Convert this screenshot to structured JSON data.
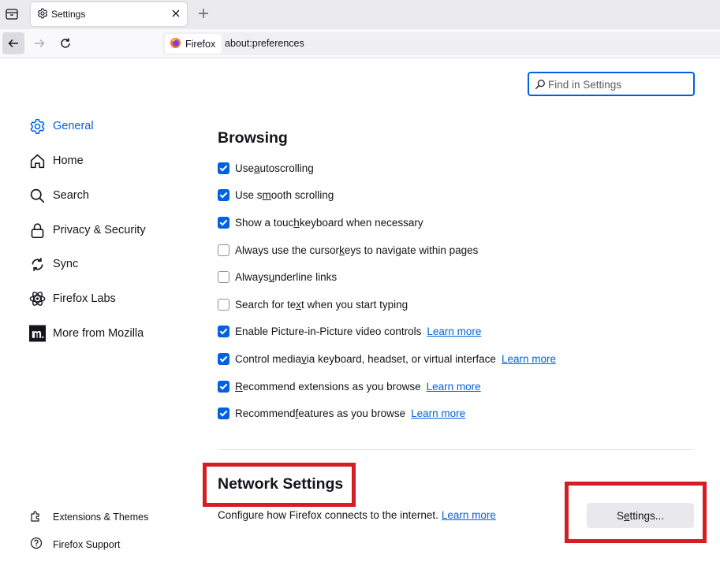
{
  "browser": {
    "tab": {
      "title": "Settings"
    },
    "identity_label": "Firefox",
    "url": "about:preferences"
  },
  "search": {
    "placeholder": "Find in Settings"
  },
  "sidebar": {
    "items": [
      {
        "label": "General",
        "icon": "gear-icon",
        "selected": true
      },
      {
        "label": "Home",
        "icon": "home-icon"
      },
      {
        "label": "Search",
        "icon": "search-icon"
      },
      {
        "label": "Privacy & Security",
        "icon": "lock-icon"
      },
      {
        "label": "Sync",
        "icon": "sync-icon"
      },
      {
        "label": "Firefox Labs",
        "icon": "atom-icon"
      },
      {
        "label": "More from Mozilla",
        "icon": "mozilla-logo-icon"
      }
    ],
    "footer": [
      {
        "label": "Extensions & Themes",
        "icon": "puzzle-icon"
      },
      {
        "label": "Firefox Support",
        "icon": "help-icon"
      }
    ]
  },
  "browsing": {
    "heading": "Browsing",
    "options": [
      {
        "pre": "Use ",
        "key": "a",
        "post": "utoscrolling",
        "checked": true
      },
      {
        "pre": "Use s",
        "key": "m",
        "post": "ooth scrolling",
        "checked": true
      },
      {
        "pre": "Show a touc",
        "key": "h",
        "post": " keyboard when necessary",
        "checked": true
      },
      {
        "pre": "Always use the cursor ",
        "key": "k",
        "post": "eys to navigate within pages",
        "checked": false
      },
      {
        "pre": "Always ",
        "key": "u",
        "post": "nderline links",
        "checked": false
      },
      {
        "pre": "Search for te",
        "key": "x",
        "post": "t when you start typing",
        "checked": false
      },
      {
        "pre": "Enable Picture-in-Picture video controls",
        "key": "",
        "post": "",
        "checked": true,
        "learn": "Learn more"
      },
      {
        "pre": "Control media ",
        "key": "v",
        "post": "ia keyboard, headset, or virtual interface",
        "checked": true,
        "learn": "Learn more"
      },
      {
        "pre": "",
        "key": "R",
        "post": "ecommend extensions as you browse",
        "checked": true,
        "learn": "Learn more"
      },
      {
        "pre": "Recommend ",
        "key": "f",
        "post": "eatures as you browse",
        "checked": true,
        "learn": "Learn more"
      }
    ]
  },
  "network": {
    "heading": "Network Settings",
    "description": "Configure how Firefox connects to the internet.",
    "learn": "Learn more",
    "button": {
      "pre": "S",
      "key": "e",
      "post": "ttings..."
    }
  },
  "colors": {
    "accent": "#0061e0",
    "highlight": "#d41e24"
  }
}
